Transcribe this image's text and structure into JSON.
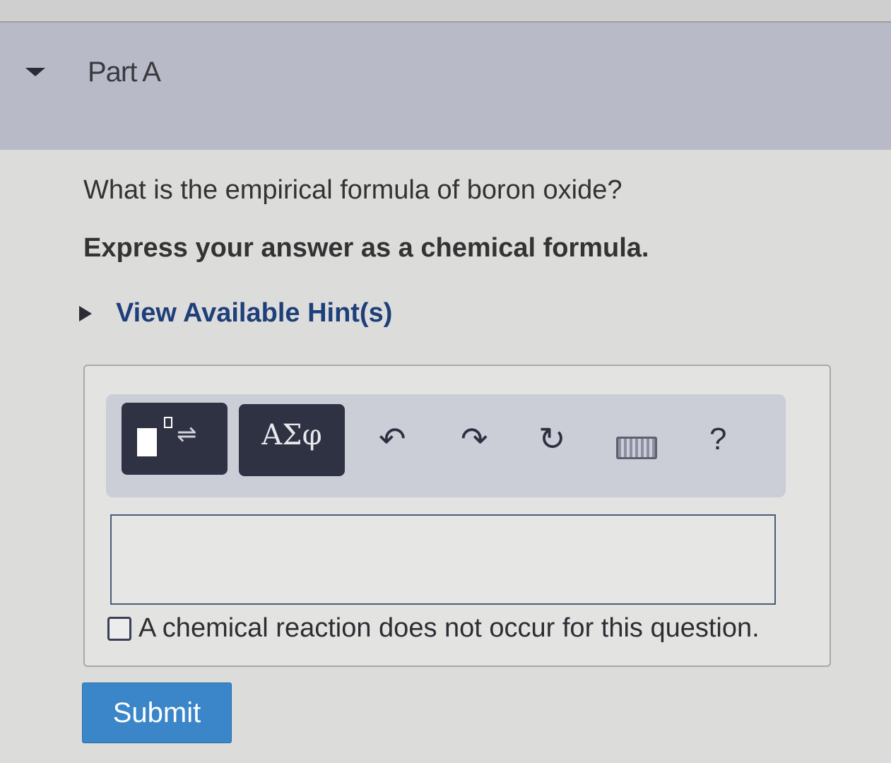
{
  "part": {
    "title": "Part A",
    "collapse_icon": "caret-down-icon"
  },
  "question": {
    "text": "What is the empirical formula of boron oxide?",
    "instruction": "Express your answer as a chemical formula."
  },
  "hint": {
    "label": "View Available Hint(s)",
    "icon": "caret-right-icon"
  },
  "toolbar": {
    "template_button": "template-icon",
    "greek_label": "ΑΣφ",
    "undo_icon": "↶",
    "redo_icon": "↷",
    "reset_icon": "↻",
    "keyboard_icon": "keyboard-icon",
    "help_label": "?"
  },
  "answer": {
    "value": "",
    "placeholder": ""
  },
  "no_reaction": {
    "label": "A chemical reaction does not occur for this question.",
    "checked": false
  },
  "submit": {
    "label": "Submit"
  },
  "colors": {
    "header_bg": "#b8bac8",
    "hint_text": "#1f3f7a",
    "toolbar_dark_button": "#2f3242",
    "submit_button": "#3a86c8"
  }
}
